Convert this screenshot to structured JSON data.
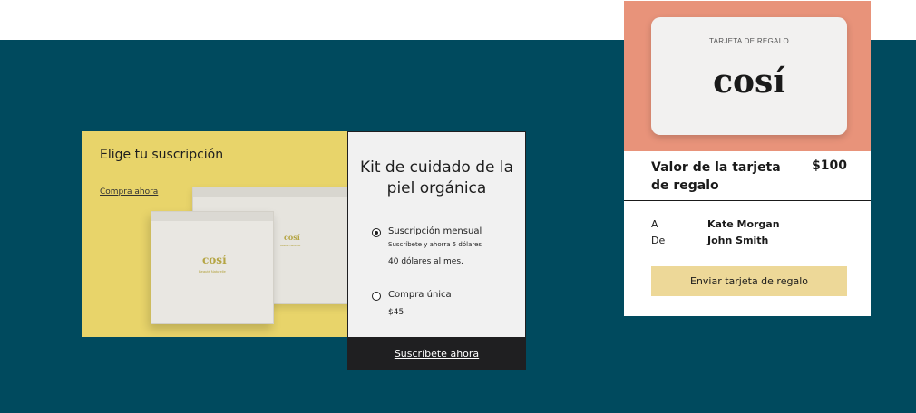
{
  "subscription_promo": {
    "title": "Elige tu suscripción",
    "link": "Compra ahora",
    "box_logo": "cosí",
    "box_subtitle": "Beauté Naturelle"
  },
  "kit": {
    "title": "Kit de cuidado de la piel orgánica",
    "options": [
      {
        "label": "Suscripción mensual",
        "note": "Suscríbete y ahorra 5 dólares",
        "price": "40 dólares al mes.",
        "selected": true
      },
      {
        "label": "Compra única",
        "note": "",
        "price": "$45",
        "selected": false
      }
    ],
    "cta": "Suscríbete ahora"
  },
  "gift_card": {
    "card_label": "TARJETA DE REGALO",
    "card_logo": "cosí",
    "title": "Valor de la tarjeta de regalo",
    "price": "$100",
    "to_label": "A",
    "to_value": "Kate Morgan",
    "from_label": "De",
    "from_value": "John Smith",
    "cta": "Enviar tarjeta de regalo"
  },
  "colors": {
    "band": "#004a5e",
    "promo_yellow": "#e8d46a",
    "gift_salmon": "#e8937a",
    "cta_dark": "#1f1f21",
    "gift_button": "#edd898"
  }
}
